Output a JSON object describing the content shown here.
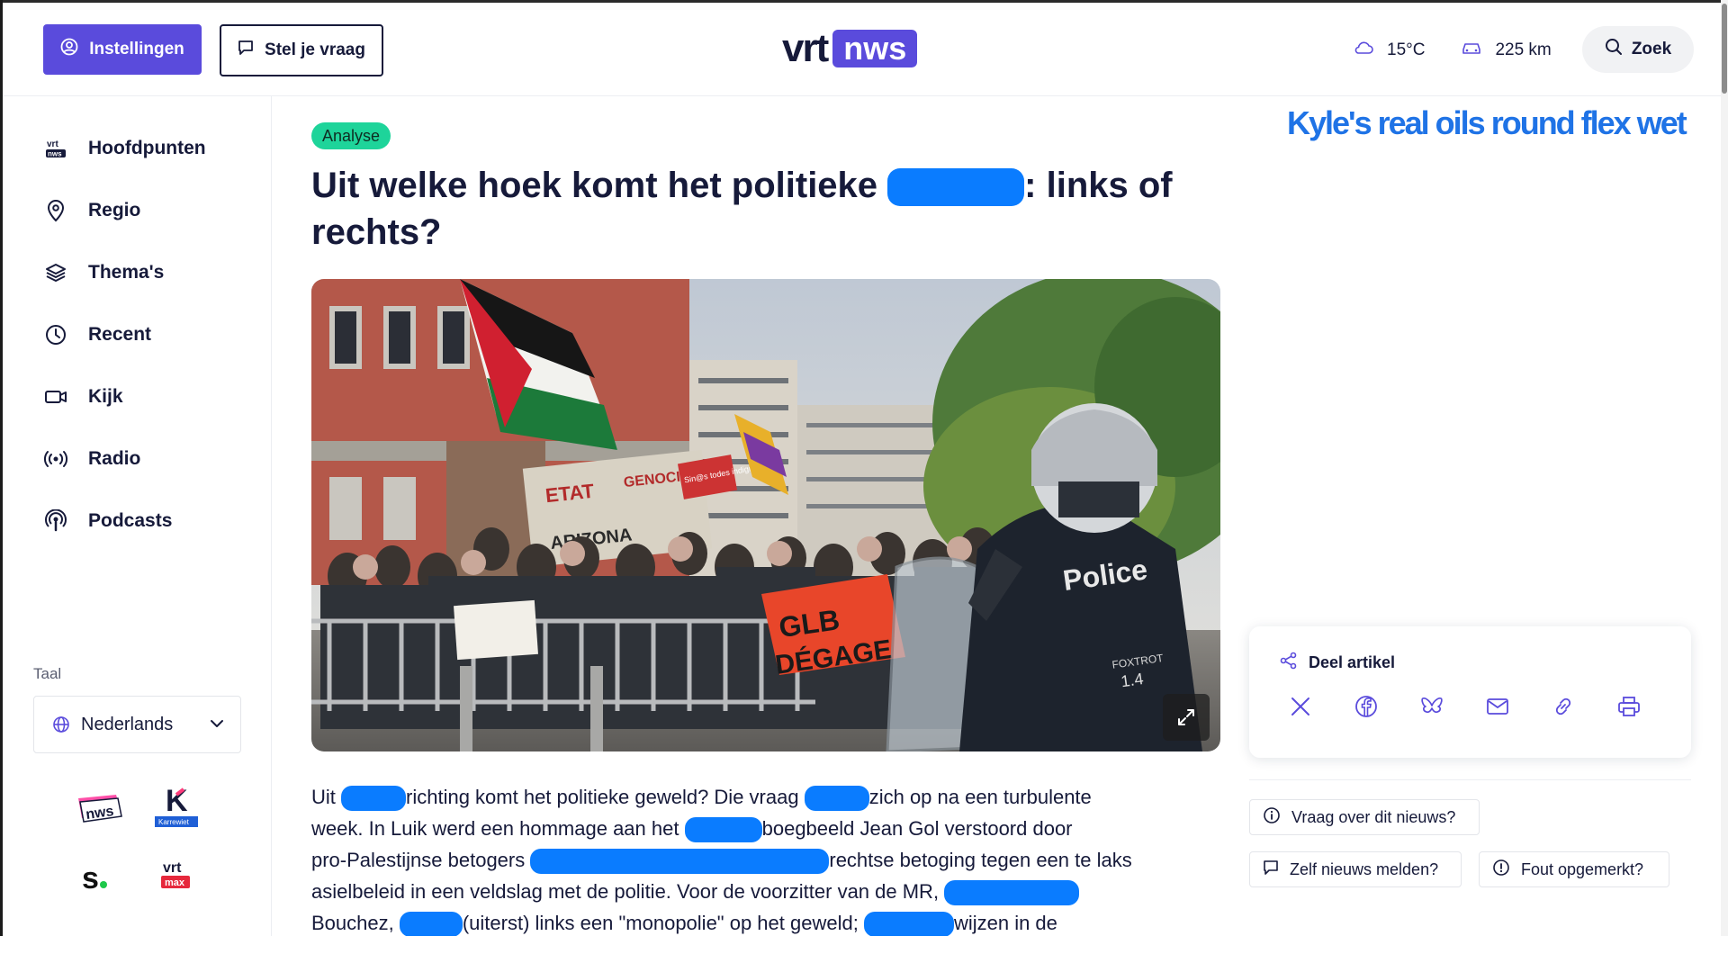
{
  "header": {
    "settings_label": "Instellingen",
    "question_label": "Stel je vraag",
    "logo_vrt": "vrt",
    "logo_nws": "nws",
    "temperature": "15°C",
    "traffic": "225 km",
    "search_label": "Zoek"
  },
  "sidebar": {
    "items": [
      {
        "label": "Hoofdpunten",
        "icon": "vrt-nws-icon"
      },
      {
        "label": "Regio",
        "icon": "location-pin-icon"
      },
      {
        "label": "Thema's",
        "icon": "layers-icon"
      },
      {
        "label": "Recent",
        "icon": "clock-icon"
      },
      {
        "label": "Kijk",
        "icon": "video-camera-icon"
      },
      {
        "label": "Radio",
        "icon": "radio-waves-icon"
      },
      {
        "label": "Podcasts",
        "icon": "podcast-icon"
      }
    ],
    "language_label": "Taal",
    "language_value": "Nederlands",
    "brands": {
      "nws": "nws",
      "karrewiet_letter": "K",
      "karrewiet": "Karrewiet",
      "sporza": "s.",
      "vrt": "vrt",
      "max": "max"
    }
  },
  "article": {
    "badge": "Analyse",
    "title_part1": "Uit welke hoek komt het politieke",
    "title_part2": ": links of",
    "title_part3": "rechts?",
    "image_texts": {
      "police": "Police",
      "foxtrot": "FOXTROT",
      "number": "1.4",
      "etat": "ETAT",
      "genocidaire": "GENOCIDAIRE",
      "arizona": "ARIZONA",
      "banner1": "GLB",
      "banner2": "DÉGAGE",
      "sign": "Sin@s todes indignad@s"
    },
    "body": {
      "l1a": "Uit",
      "l1b": "richting komt het politieke geweld? Die vraag",
      "l1c": "zich op na een turbulente",
      "l2a": "week. In Luik werd een hommage aan het",
      "l2b": "boegbeeld Jean Gol verstoord door",
      "l3a": "pro-Palestijnse betogers",
      "l3b": "rechtse betoging tegen een te laks",
      "l4a": "asielbeleid in een veldslag met de politie. Voor de voorzitter van de MR,",
      "l5a": "Bouchez,",
      "l5b": "(uiterst) links een \"monopolie\" op het geweld;",
      "l5c": "wijzen in de"
    }
  },
  "right": {
    "ad_text": "Kyle's real oils round flex wet",
    "share_title": "Deel artikel",
    "share_icons": [
      "x-icon",
      "facebook-icon",
      "bluesky-icon",
      "mail-icon",
      "link-icon",
      "print-icon"
    ],
    "question_news": "Vraag over dit nieuws?",
    "report_news": "Zelf nieuws melden?",
    "error_noticed": "Fout opgemerkt?"
  },
  "colors": {
    "accent": "#5a4bdc",
    "badge": "#1ed49a",
    "redaction": "#0a7cff",
    "ad": "#1f73e6"
  }
}
